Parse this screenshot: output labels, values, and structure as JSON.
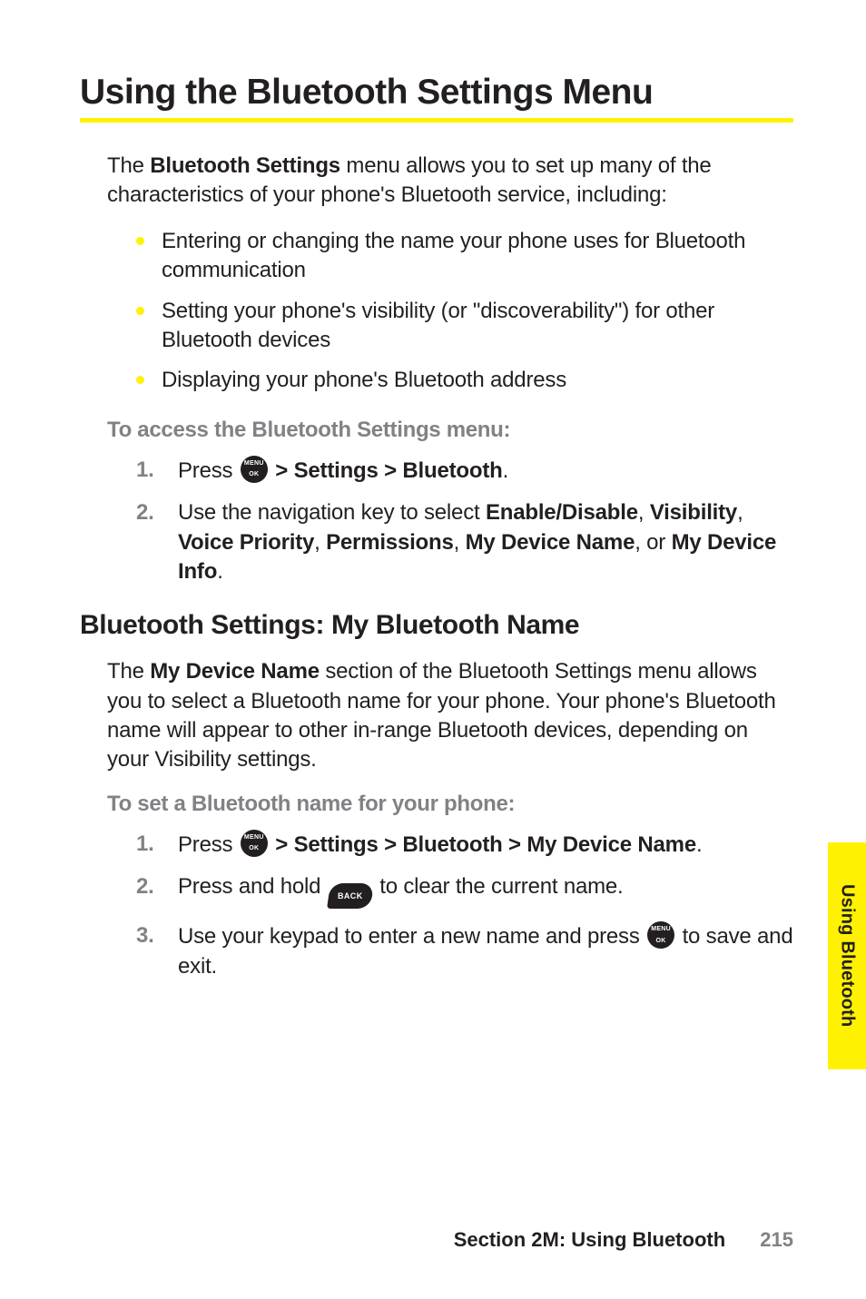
{
  "title": "Using the Bluetooth Settings Menu",
  "intro_before_bold": "The ",
  "intro_bold": "Bluetooth Settings",
  "intro_after_bold": " menu allows you to set up many of the characteristics of your phone's Bluetooth service, including:",
  "bullets": [
    "Entering or changing the name your phone uses for Bluetooth communication",
    "Setting your phone's visibility (or \"discoverability\") for other Bluetooth devices",
    "Displaying your phone's Bluetooth address"
  ],
  "subhead1": "To access the Bluetooth Settings menu:",
  "steps1": {
    "s1": {
      "num": "1.",
      "pre": "Press ",
      "bold": " > Settings > Bluetooth",
      "post": "."
    },
    "s2": {
      "num": "2.",
      "t1": "Use the navigation key to select ",
      "b1": "Enable/Disable",
      "t2": ", ",
      "b2": "Visibility",
      "t3": ", ",
      "b3": "Voice Priority",
      "t4": ", ",
      "b4": "Permissions",
      "t5": ", ",
      "b5": "My Device Name",
      "t6": ", or ",
      "b6": "My Device Info",
      "t7": "."
    }
  },
  "h2": "Bluetooth Settings: My Bluetooth Name",
  "para2_t1": "The ",
  "para2_b1": "My Device Name",
  "para2_t2": " section of the Bluetooth Settings menu allows you to select a Bluetooth name for your phone. Your phone's Bluetooth name will appear to other in-range Bluetooth devices, depending on your Visibility settings.",
  "subhead2": "To set a Bluetooth name for your phone:",
  "steps2": {
    "s1": {
      "num": "1.",
      "pre": "Press ",
      "bold": " > Settings > Bluetooth > My Device Name",
      "post": "."
    },
    "s2": {
      "num": "2.",
      "pre": "Press and hold ",
      "post": " to clear the current name."
    },
    "s3": {
      "num": "3.",
      "pre": "Use your keypad to enter a new name and press ",
      "post": " to save and exit."
    }
  },
  "icon_back_label": "BACK",
  "side_tab": "Using Bluetooth",
  "footer_section": "Section 2M: Using Bluetooth",
  "footer_page": "215"
}
